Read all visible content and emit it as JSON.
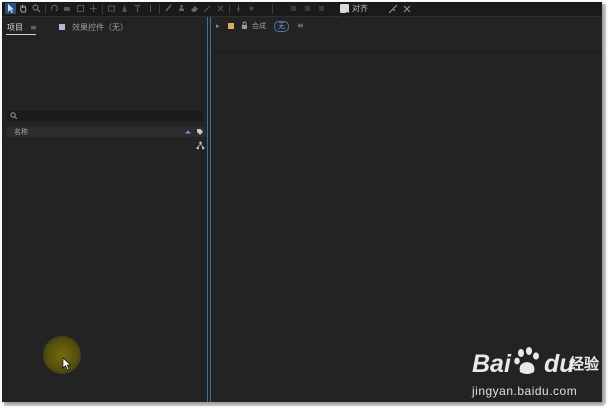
{
  "toolbar": {
    "tools": [
      "selection-tool",
      "hand-tool",
      "zoom-tool",
      "rotate-tool",
      "camera-tool",
      "pan-behind-tool",
      "mask-tool",
      "pen-tool",
      "type-tool",
      "brush-tool",
      "clone-stamp-tool",
      "eraser-tool",
      "roto-brush-tool",
      "puppet-pin-tool"
    ],
    "snap_label": "对齐",
    "snap_checked": true
  },
  "project_panel": {
    "tab_label": "项目",
    "tab_menu": "≡",
    "effects_tab_label": "效果控件（无）",
    "column_name": "名称"
  },
  "composition_panel": {
    "label": "合成",
    "value": "无",
    "menu": "≡"
  },
  "watermark": {
    "brand_left": "Bai",
    "brand_right": "du",
    "brand_cn": "经验",
    "url": "jingyan.baidu.com"
  },
  "colors": {
    "panel_bg": "#232323",
    "active_border": "#3d6fb0",
    "effects_swatch": "#b7b1e0",
    "comp_swatch": "#e0a85a",
    "cursor_highlight": "#7a700a"
  }
}
